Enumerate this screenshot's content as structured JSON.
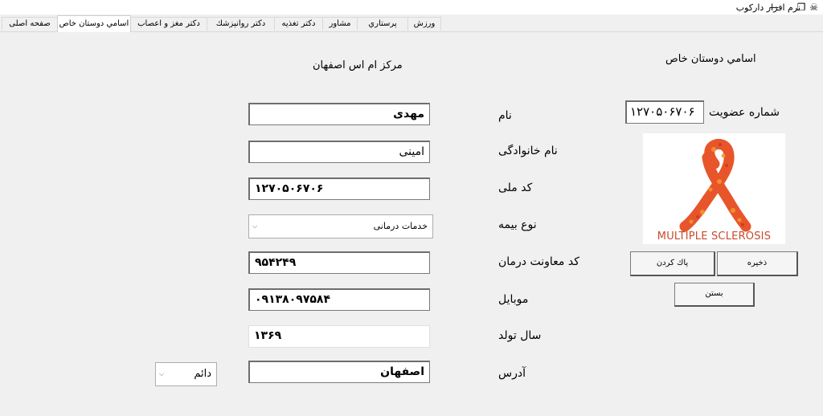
{
  "window": {
    "title": "نرم افزار داركوب",
    "app_icon": "app-icon",
    "minimize_glyph": "—",
    "restore_glyph": "❐"
  },
  "tabs": [
    {
      "label": "صفحه اصلی",
      "active": false
    },
    {
      "label": "اسامي دوستان خاص",
      "active": true
    },
    {
      "label": "دكتر مغز و اعصاب",
      "active": false
    },
    {
      "label": "دكتر روانپزشك",
      "active": false
    },
    {
      "label": "دكتر تغذيه",
      "active": false
    },
    {
      "label": "مشاور",
      "active": false
    },
    {
      "label": "پرستاري",
      "active": false
    },
    {
      "label": "ورزش",
      "active": false
    }
  ],
  "page": {
    "section_title": "اسامي دوستان خاص",
    "center_title": "مركز ام اس اصفهان"
  },
  "membership": {
    "label": "شماره عضويت",
    "value": "۱۲۷۰۵۰۶۷۰۶"
  },
  "form": {
    "name": {
      "label": "نام",
      "value": "مهدی"
    },
    "family": {
      "label": "نام خانوادگی",
      "value": "امینی"
    },
    "national_id": {
      "label": "كد ملی",
      "value": "۱۲۷۰۵۰۶۷۰۶"
    },
    "insurance": {
      "label": "نوع بيمه",
      "value": "خدمات درمانی"
    },
    "assistance_code": {
      "label": "كد معاونت درمان",
      "value": "۹۵۴۲۴۹"
    },
    "mobile": {
      "label": "موبايل",
      "value": "۰۹۱۳۸۰۹۷۵۸۴"
    },
    "birth_year": {
      "label": "سال تولد",
      "value": "۱۳۶۹"
    },
    "address": {
      "label": "آدرس",
      "value": "اصفهان"
    },
    "address_type": {
      "value": "دائم"
    }
  },
  "buttons": {
    "save": "ذخيره",
    "clear": "پاك كردن",
    "close": "بستن"
  },
  "logo": {
    "caption": "MULTIPLE SCLEROSIS",
    "color": "#e8552b",
    "icon": "ms-ribbon-icon"
  }
}
